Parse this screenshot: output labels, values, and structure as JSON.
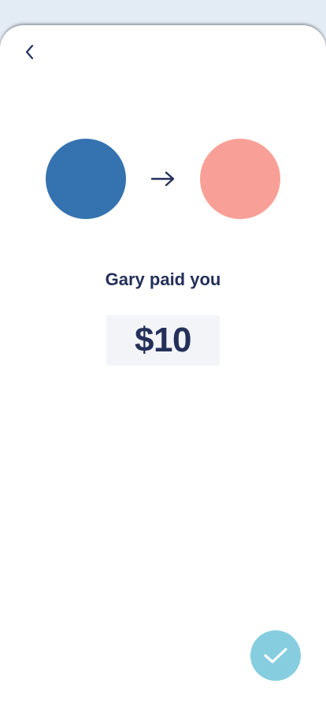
{
  "colors": {
    "background": "#e3ebf5",
    "sheet": "#ffffff",
    "text": "#24305a",
    "from_avatar": "#3572b0",
    "to_avatar": "#f8a097",
    "amount_box": "#f2f4f7",
    "confirm_button": "#86cde0"
  },
  "icons": {
    "back": "chevron-left-icon",
    "arrow": "arrow-right-icon",
    "confirm": "checkmark-icon"
  },
  "payment": {
    "title": "Gary paid you",
    "amount": "$10"
  }
}
